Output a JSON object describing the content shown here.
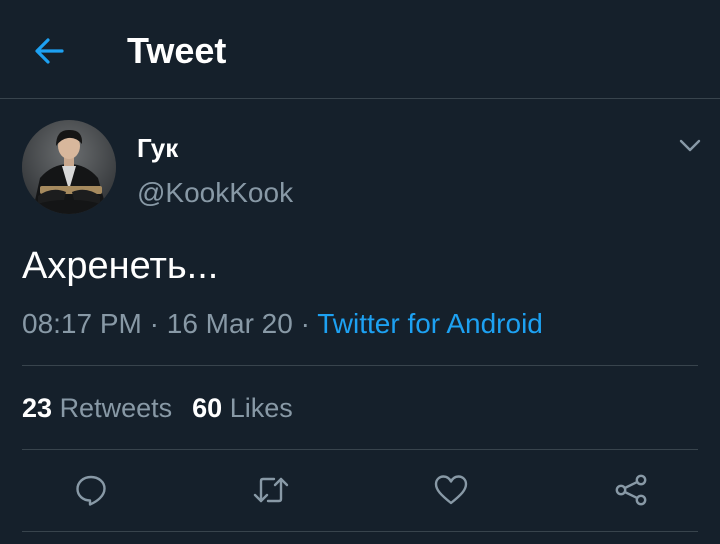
{
  "header": {
    "title": "Tweet",
    "back_icon": "arrow-left-icon"
  },
  "author": {
    "name": "Гук",
    "handle": "@KookKook",
    "menu_icon": "chevron-down-icon"
  },
  "tweet": {
    "text": "Ахренеть...",
    "time": "08:17 PM",
    "separator": "·",
    "date": "16 Mar 20",
    "source": "Twitter for Android"
  },
  "stats": {
    "retweets_count": "23",
    "retweets_label": "Retweets",
    "likes_count": "60",
    "likes_label": "Likes"
  },
  "actions": {
    "icons": [
      "reply-icon",
      "retweet-icon",
      "like-icon",
      "share-icon"
    ]
  },
  "colors": {
    "background": "#15202b",
    "accent": "#1da1f2",
    "secondary_text": "#8899a6",
    "divider": "#38444d"
  }
}
